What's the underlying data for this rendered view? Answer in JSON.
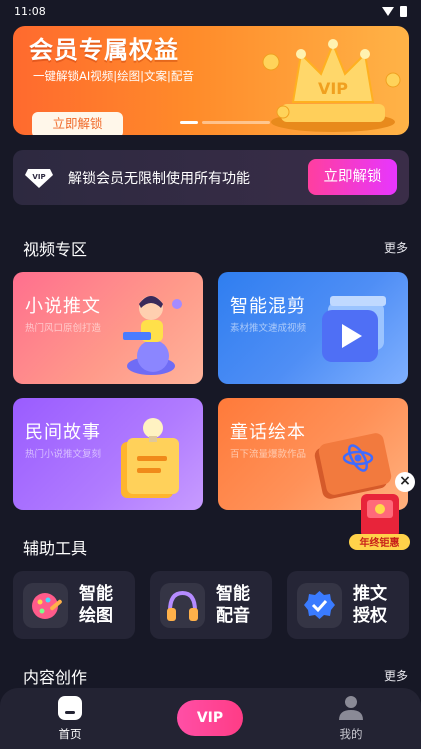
{
  "status_bar": {
    "time": "11:08"
  },
  "banner": {
    "title": "会员专属权益",
    "subtitle": "一键解锁AI视频|绘图|文案|配音",
    "button": "立即解锁",
    "badge": "VIP",
    "slide_index": 1,
    "slide_count": 2
  },
  "vip_strip": {
    "gem_label": "VIP",
    "text": "解锁会员无限制使用所有功能",
    "button": "立即解锁"
  },
  "video_section": {
    "title": "视频专区",
    "more": "更多",
    "cards": [
      {
        "title": "小说推文",
        "subtitle": "热门风口原创打造"
      },
      {
        "title": "智能混剪",
        "subtitle": "素材推文速成视频"
      },
      {
        "title": "民间故事",
        "subtitle": "热门小说推文复刻"
      },
      {
        "title": "童话绘本",
        "subtitle": "百下流量爆款作品"
      }
    ]
  },
  "tools_section": {
    "title": "辅助工具",
    "tools": [
      {
        "line1": "智能",
        "line2": "绘图",
        "icon": "palette-icon"
      },
      {
        "line1": "智能",
        "line2": "配音",
        "icon": "headphones-icon"
      },
      {
        "line1": "推文",
        "line2": "授权",
        "icon": "verified-badge-icon"
      }
    ]
  },
  "content_section": {
    "title": "内容创作",
    "more": "更多"
  },
  "floating_promo": {
    "label": "年终钜惠",
    "close": "×"
  },
  "bottom_nav": {
    "home": "首页",
    "vip": "VIP",
    "mine": "我的"
  },
  "colors": {
    "background": "#171826",
    "banner": "#ff7a2a",
    "accent_pink": "#ff3f9f",
    "card_pink": "#ff7e9a",
    "card_blue": "#3d8cf3",
    "card_purple": "#a469ff",
    "card_orange": "#ff8f4f"
  }
}
